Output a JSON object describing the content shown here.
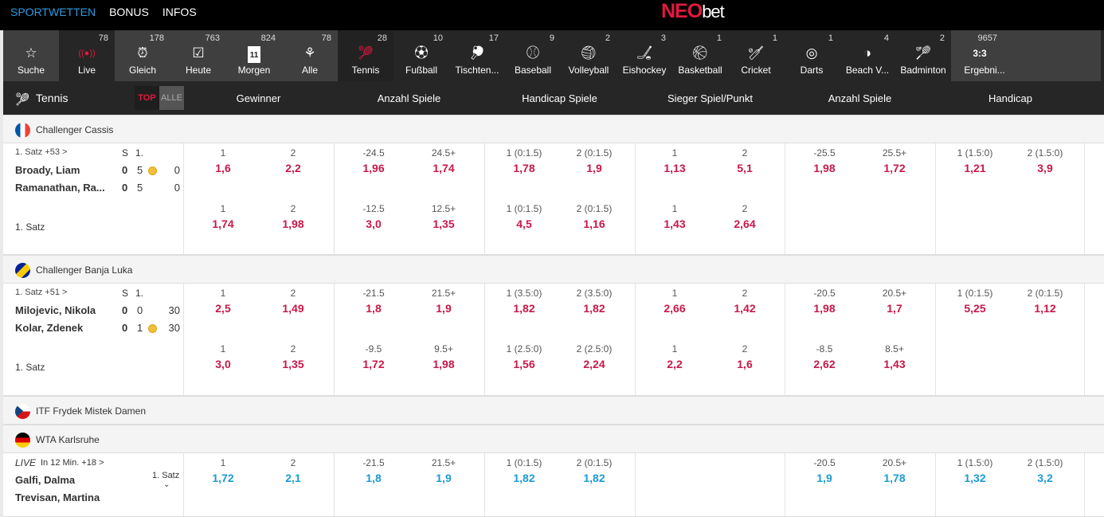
{
  "nav": {
    "items": [
      "SPORTWETTEN",
      "BONUS",
      "INFOS"
    ],
    "brand_neo": "NEO",
    "brand_bet": "bet"
  },
  "sports": [
    {
      "name": "Suche",
      "count": "",
      "icon": "search-icon"
    },
    {
      "name": "Live",
      "count": "78",
      "icon": "live-icon"
    },
    {
      "name": "Gleich",
      "count": "178",
      "icon": "alarm-clock-icon"
    },
    {
      "name": "Heute",
      "count": "763",
      "icon": "calendar-check-icon"
    },
    {
      "name": "Morgen",
      "count": "824",
      "icon": "calendar-11-icon",
      "glyph": "11"
    },
    {
      "name": "Alle",
      "count": "78",
      "icon": "all-sports-icon"
    },
    {
      "name": "Tennis",
      "count": "28",
      "icon": "tennis-icon"
    },
    {
      "name": "Fußball",
      "count": "10",
      "icon": "soccer-ball-icon"
    },
    {
      "name": "Tischten...",
      "count": "17",
      "icon": "table-tennis-icon"
    },
    {
      "name": "Baseball",
      "count": "9",
      "icon": "baseball-icon"
    },
    {
      "name": "Volleyball",
      "count": "2",
      "icon": "volleyball-icon"
    },
    {
      "name": "Eishockey",
      "count": "3",
      "icon": "ice-hockey-icon"
    },
    {
      "name": "Basketball",
      "count": "1",
      "icon": "basketball-icon"
    },
    {
      "name": "Cricket",
      "count": "1",
      "icon": "cricket-icon"
    },
    {
      "name": "Darts",
      "count": "1",
      "icon": "darts-icon"
    },
    {
      "name": "Beach V...",
      "count": "4",
      "icon": "beach-volleyball-icon"
    },
    {
      "name": "Badminton",
      "count": "2",
      "icon": "badminton-icon"
    },
    {
      "name": "Ergebni...",
      "count": "9657",
      "icon": "results-icon",
      "glyph": "3:3"
    }
  ],
  "subheader": {
    "sport": "Tennis",
    "toggle_top": "TOP",
    "toggle_all": "ALLE",
    "markets": [
      "Gewinner",
      "Anzahl Spiele",
      "Handicap Spiele",
      "Sieger Spiel/Punkt",
      "Anzahl Spiele",
      "Handicap"
    ]
  },
  "leagues": [
    {
      "name": "Challenger Cassis",
      "flag": "france",
      "events": [
        {
          "info": "1. Satz +53 >",
          "colS": "S",
          "col1": "1.",
          "players": [
            {
              "name": "Broady, Liam",
              "s": "0",
              "g": "5",
              "p": "0",
              "serve": true
            },
            {
              "name": "Ramanathan, Ra...",
              "s": "0",
              "g": "5",
              "p": "0",
              "serve": false
            }
          ],
          "row2": "1. Satz",
          "blue": false,
          "odds": [
            [
              [
                "1",
                "1,6"
              ],
              [
                "2",
                "2,2"
              ],
              [
                "-24.5",
                "1,96"
              ],
              [
                "24.5+",
                "1,74"
              ],
              [
                "1 (0:1.5)",
                "1,78"
              ],
              [
                "2 (0:1.5)",
                "1,9"
              ],
              [
                "1",
                "1,13"
              ],
              [
                "2",
                "5,1"
              ],
              [
                "-25.5",
                "1,98"
              ],
              [
                "25.5+",
                "1,72"
              ],
              [
                "1 (1.5:0)",
                "1,21"
              ],
              [
                "2 (1.5:0)",
                "3,9"
              ]
            ],
            [
              [
                "1",
                "1,74"
              ],
              [
                "2",
                "1,98"
              ],
              [
                "-12.5",
                "3,0"
              ],
              [
                "12.5+",
                "1,35"
              ],
              [
                "1 (0:1.5)",
                "4,5"
              ],
              [
                "2 (0:1.5)",
                "1,16"
              ],
              [
                "1",
                "1,43"
              ],
              [
                "2",
                "2,64"
              ]
            ]
          ]
        }
      ]
    },
    {
      "name": "Challenger Banja Luka",
      "flag": "bosnia",
      "events": [
        {
          "info": "1. Satz +51 >",
          "colS": "S",
          "col1": "1.",
          "players": [
            {
              "name": "Milojevic, Nikola",
              "s": "0",
              "g": "0",
              "p": "30",
              "serve": false
            },
            {
              "name": "Kolar, Zdenek",
              "s": "0",
              "g": "1",
              "p": "30",
              "serve": true
            }
          ],
          "row2": "1. Satz",
          "blue": false,
          "odds": [
            [
              [
                "1",
                "2,5"
              ],
              [
                "2",
                "1,49"
              ],
              [
                "-21.5",
                "1,8"
              ],
              [
                "21.5+",
                "1,9"
              ],
              [
                "1 (3.5:0)",
                "1,82"
              ],
              [
                "2 (3.5:0)",
                "1,82"
              ],
              [
                "1",
                "2,66"
              ],
              [
                "2",
                "1,42"
              ],
              [
                "-20.5",
                "1,98"
              ],
              [
                "20.5+",
                "1,7"
              ],
              [
                "1 (0:1.5)",
                "5,25"
              ],
              [
                "2 (0:1.5)",
                "1,12"
              ]
            ],
            [
              [
                "1",
                "3,0"
              ],
              [
                "2",
                "1,35"
              ],
              [
                "-9.5",
                "1,72"
              ],
              [
                "9.5+",
                "1,98"
              ],
              [
                "1 (2.5:0)",
                "1,56"
              ],
              [
                "2 (2.5:0)",
                "2,24"
              ],
              [
                "1",
                "2,2"
              ],
              [
                "2",
                "1,6"
              ],
              [
                "-8.5",
                "2,62"
              ],
              [
                "8.5+",
                "1,43"
              ]
            ]
          ]
        }
      ]
    },
    {
      "name": "ITF Frydek Mistek Damen",
      "flag": "czech",
      "events": []
    },
    {
      "name": "WTA Karlsruhe",
      "flag": "germany",
      "events": [
        {
          "info_live": "LIVE",
          "info": "In 12 Min. +18 >",
          "set_label": "1. Satz",
          "players": [
            {
              "name": "Galfi, Dalma"
            },
            {
              "name": "Trevisan, Martina"
            }
          ],
          "blue": true,
          "odds": [
            [
              [
                "1",
                "1,72"
              ],
              [
                "2",
                "2,1"
              ],
              [
                "-21.5",
                "1,8"
              ],
              [
                "21.5+",
                "1,9"
              ],
              [
                "1 (0:1.5)",
                "1,82"
              ],
              [
                "2 (0:1.5)",
                "1,82"
              ],
              null,
              null,
              [
                "-20.5",
                "1,9"
              ],
              [
                "20.5+",
                "1,78"
              ],
              [
                "1 (1.5:0)",
                "1,32"
              ],
              [
                "2 (1.5:0)",
                "3,2"
              ]
            ]
          ]
        }
      ]
    }
  ],
  "colors": {
    "accent": "#e3183f",
    "odds": "#c8184a",
    "live_odds": "#1b9bd4"
  }
}
